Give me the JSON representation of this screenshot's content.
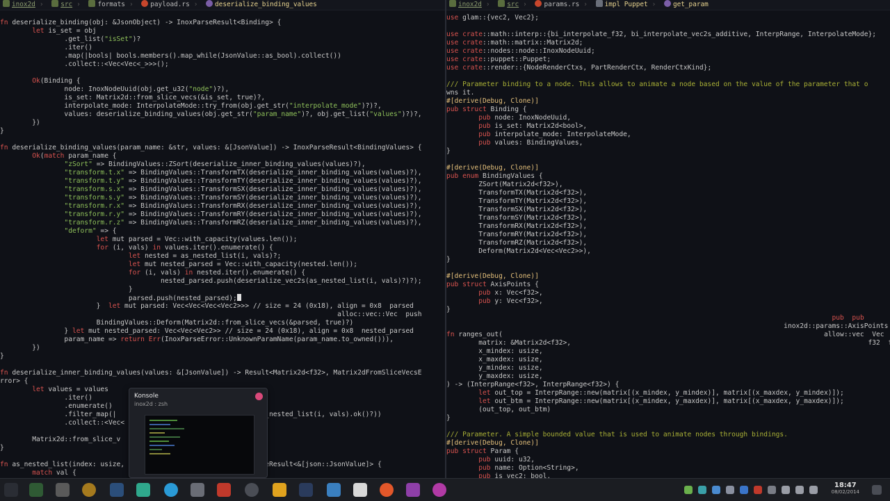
{
  "left_pane": {
    "breadcrumb": [
      "inox2d",
      "src",
      "formats",
      "payload.rs",
      "deserialize_binding_values"
    ],
    "lines": [
      "fn deserialize_binding(obj: &JsonObject) -> InoxParseResult<Binding> {",
      "        let is_set = obj",
      "                .get_list(\"isSet\")?",
      "                .iter()",
      "                .map(|bools| bools.members().map_while(JsonValue::as_bool).collect())",
      "                .collect::<Vec<Vec<_>>>();",
      "",
      "        Ok(Binding {",
      "                node: InoxNodeUuid(obj.get_u32(\"node\")?),",
      "                is_set: Matrix2d::from_slice_vecs(&is_set, true)?,",
      "                interpolate_mode: InterpolateMode::try_from(obj.get_str(\"interpolate_mode\")?)?,",
      "                values: deserialize_binding_values(obj.get_str(\"param_name\")?, obj.get_list(\"values\")?)?,",
      "        })",
      "}",
      "",
      "fn deserialize_binding_values(param_name: &str, values: &[JsonValue]) -> InoxParseResult<BindingValues> {",
      "        Ok(match param_name {",
      "                \"zSort\" => BindingValues::ZSort(deserialize_inner_binding_values(values)?),",
      "                \"transform.t.x\" => BindingValues::TransformTX(deserialize_inner_binding_values(values)?),",
      "                \"transform.t.y\" => BindingValues::TransformTY(deserialize_inner_binding_values(values)?),",
      "                \"transform.s.x\" => BindingValues::TransformSX(deserialize_inner_binding_values(values)?),",
      "                \"transform.s.y\" => BindingValues::TransformSY(deserialize_inner_binding_values(values)?),",
      "                \"transform.r.x\" => BindingValues::TransformRX(deserialize_inner_binding_values(values)?),",
      "                \"transform.r.y\" => BindingValues::TransformRY(deserialize_inner_binding_values(values)?),",
      "                \"transform.r.z\" => BindingValues::TransformRZ(deserialize_inner_binding_values(values)?),",
      "                \"deform\" => {",
      "                        let mut parsed = Vec::with_capacity(values.len());",
      "                        for (i, vals) in values.iter().enumerate() {",
      "                                let nested = as_nested_list(i, vals)?;",
      "                                let mut nested_parsed = Vec::with_capacity(nested.len());",
      "                                for (i, vals) in nested.iter().enumerate() {",
      "                                        nested_parsed.push(deserialize_vec2s(as_nested_list(i, vals)?)?);",
      "                                }",
      "                                parsed.push(nested_parsed);",
      "                        }  let mut parsed: Vec<Vec<Vec<Vec2>>> // size = 24 (0x18), align = 0x8  parsed",
      "                                                                                    alloc::vec::Vec  push",
      "                        BindingValues::Deform(Matrix2d::from_slice_vecs(&parsed, true)?)",
      "                } let mut nested_parsed: Vec<Vec<Vec2>> // size = 24 (0x18), align = 0x8  nested_parsed",
      "                param_name => return Err(InoxParseError::UnknownParamName(param_name.to_owned())),",
      "        })",
      "}",
      "",
      "fn deserialize_inner_binding_values(values: &[JsonValue]) -> Result<Matrix2d<f32>, Matrix2dFromSliceVecsE",
      "rror> {",
      "        let values = values",
      "                .iter()",
      "                .enumerate()",
      "                .filter_map(|                                   as_nested_list(i, vals).ok()?))",
      "                .collect::<Vec<",
      "",
      "        Matrix2d::from_slice_v",
      "}",
      "",
      "fn as_nested_list(index: usize,                               ParseResult<&[json::JsonValue]> {",
      "        match val {"
    ]
  },
  "right_pane": {
    "breadcrumb": [
      "inox2d",
      "src",
      "params.rs",
      "impl Puppet",
      "get_param"
    ],
    "lines": [
      "use glam::{vec2, Vec2};",
      "",
      "use crate::math::interp::{bi_interpolate_f32, bi_interpolate_vec2s_additive, InterpRange, InterpolateMode};",
      "use crate::math::matrix::Matrix2d;",
      "use crate::nodes::node::InoxNodeUuid;",
      "use crate::puppet::Puppet;",
      "use crate::render::{NodeRenderCtxs, PartRenderCtx, RenderCtxKind};",
      "",
      "/// Parameter binding to a node. This allows to animate a node based on the value of the parameter that o",
      "wns it.",
      "#[derive(Debug, Clone)]",
      "pub struct Binding {",
      "        pub node: InoxNodeUuid,",
      "        pub is_set: Matrix2d<bool>,",
      "        pub interpolate_mode: InterpolateMode,",
      "        pub values: BindingValues,",
      "}",
      "",
      "#[derive(Debug, Clone)]",
      "pub enum BindingValues {",
      "        ZSort(Matrix2d<f32>),",
      "        TransformTX(Matrix2d<f32>),",
      "        TransformTY(Matrix2d<f32>),",
      "        TransformSX(Matrix2d<f32>),",
      "        TransformSY(Matrix2d<f32>),",
      "        TransformRX(Matrix2d<f32>),",
      "        TransformRY(Matrix2d<f32>),",
      "        TransformRZ(Matrix2d<f32>),",
      "        Deform(Matrix2d<Vec<Vec2>>),",
      "}",
      "",
      "#[derive(Debug, Clone)]",
      "pub struct AxisPoints {",
      "        pub x: Vec<f32>,",
      "        pub y: Vec<f32>,",
      "}",
      "                                                                                                pub  pub",
      "                                                                                    inox2d::params::AxisPoints",
      "fn ranges_out(                                                                                allow::vec  Vec",
      "        matrix: &Matrix2d<f32>,                                                                          f32  f32",
      "        x_mindex: usize,",
      "        x_maxdex: usize,",
      "        y_mindex: usize,",
      "        y_maxdex: usize,",
      ") -> (InterpRange<f32>, InterpRange<f32>) {",
      "        let out_top = InterpRange::new(matrix[(x_mindex, y_mindex)], matrix[(x_maxdex, y_mindex)]);",
      "        let out_btm = InterpRange::new(matrix[(x_mindex, y_maxdex)], matrix[(x_maxdex, y_maxdex)]);",
      "        (out_top, out_btm)",
      "}",
      "",
      "/// Parameter. A simple bounded value that is used to animate nodes through bindings.",
      "#[derive(Debug, Clone)]",
      "pub struct Param {",
      "        pub uuid: u32,",
      "        pub name: Option<String>,",
      "        pub is_vec2: bool,"
    ]
  },
  "popup": {
    "title": "Konsole",
    "subtitle": "inox2d : zsh"
  },
  "taskbar": {
    "time": "18:47",
    "date": "08/02/2014"
  },
  "colors": {
    "keyword": "#d9534f",
    "function": "#e5c07b",
    "type": "#c86d3a",
    "string": "#8fc15a",
    "comment": "#a9b036",
    "background": "#0f1117"
  }
}
